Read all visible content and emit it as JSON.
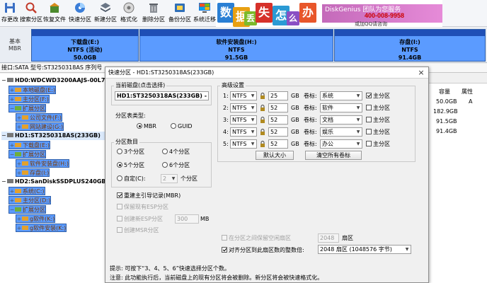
{
  "toolbar": {
    "buttons": [
      {
        "label": "存更改",
        "icon": "save-icon"
      },
      {
        "label": "搜索分区",
        "icon": "search-partition-icon"
      },
      {
        "label": "恢复文件",
        "icon": "recover-files-icon"
      },
      {
        "label": "快速分区",
        "icon": "quick-partition-icon"
      },
      {
        "label": "新建分区",
        "icon": "new-partition-icon"
      },
      {
        "label": "格式化",
        "icon": "format-icon"
      },
      {
        "label": "删除分区",
        "icon": "delete-partition-icon"
      },
      {
        "label": "备份分区",
        "icon": "backup-partition-icon"
      },
      {
        "label": "系统迁移",
        "icon": "system-migration-icon"
      }
    ]
  },
  "banner": {
    "chars": [
      "数",
      "据",
      "丢",
      "失",
      "怎",
      "么",
      "办"
    ],
    "brand": "DiskGenius 团队为您服务",
    "phone": "400-008-9958",
    "qq": "或加QQ请咨询"
  },
  "diskbar": {
    "disk_label_line1": "基本",
    "disk_label_line2": "MBR",
    "partitions": [
      {
        "name": "下载盘(E:)",
        "fs": "NTFS (活动)",
        "size": "50.0GB"
      },
      {
        "name": "软件安装盘(H:)",
        "fs": "NTFS",
        "size": "91.5GB"
      },
      {
        "name": "存盘(I:)",
        "fs": "NTFS",
        "size": "91.4GB"
      }
    ]
  },
  "infoline": "接口:SATA  型号:ST3250318AS  序列号",
  "tree": {
    "nodes": [
      {
        "text": "HD0:WDCWD3200AAJS-00L7A0(2",
        "kind": "disk"
      },
      {
        "text": "本地磁盘(E:)",
        "kind": "part"
      },
      {
        "text": "主分区(F:)",
        "kind": "part"
      },
      {
        "text": "扩展分区",
        "kind": "part"
      },
      {
        "text": "公司文件(F:)",
        "kind": "part"
      },
      {
        "text": "网站建设(G:)",
        "kind": "part"
      },
      {
        "text": "HD1:ST3250318AS(233GB)",
        "kind": "disk"
      },
      {
        "text": "下载盘(E:)",
        "kind": "part"
      },
      {
        "text": "扩展分区",
        "kind": "part"
      },
      {
        "text": "软件安装盘(H:)",
        "kind": "part"
      },
      {
        "text": "存盘(I:)",
        "kind": "part"
      },
      {
        "text": "HD2:SanDiskSSDPLUS240GB(224",
        "kind": "disk"
      },
      {
        "text": "系统(C:)",
        "kind": "part"
      },
      {
        "text": "主分区(D:)",
        "kind": "part"
      },
      {
        "text": "扩展分区",
        "kind": "part"
      },
      {
        "text": "g软件(K:)",
        "kind": "part"
      },
      {
        "text": "g软件安装(K:)",
        "kind": "part"
      }
    ]
  },
  "rtable": {
    "col_capacity": "容量",
    "col_attr": "属性",
    "rows": [
      {
        "capacity": "50.0GB",
        "attr": "A"
      },
      {
        "capacity": "182.9GB",
        "attr": ""
      },
      {
        "capacity": "91.5GB",
        "attr": ""
      },
      {
        "capacity": "91.4GB",
        "attr": ""
      }
    ]
  },
  "dialog": {
    "title": "快速分区 - HD1:ST3250318AS(233GB)",
    "close": "×",
    "current_disk_group": "当前磁盘(点击选择)",
    "current_disk_value": "HD1:ST3250318AS(233GB) - 下载盘",
    "table_type_group": "分区表类型:",
    "mbr": "MBR",
    "guid": "GUID",
    "count_group": "分区数目",
    "count_options": [
      "3个分区",
      "4个分区",
      "5个分区",
      "6个分区"
    ],
    "custom_label": "自定(C):",
    "custom_value": "2",
    "custom_unit": "个分区",
    "rebuild_mbr": "重建主引导记录(MBR)",
    "keep_esp": "保留现有ESP分区",
    "create_esp": "创建新ESP分区",
    "esp_size": "300",
    "esp_unit": "MB",
    "create_msr": "创建MSR分区",
    "advanced_group": "高级设置",
    "rows": [
      {
        "idx": "1:",
        "fs": "NTFS",
        "size": "25",
        "unit": "GB",
        "vol_label": "卷标:",
        "vol": "系统",
        "primary": true,
        "primary_label": "主分区"
      },
      {
        "idx": "2:",
        "fs": "NTFS",
        "size": "52",
        "unit": "GB",
        "vol_label": "卷标:",
        "vol": "软件",
        "primary": false,
        "primary_label": "主分区"
      },
      {
        "idx": "3:",
        "fs": "NTFS",
        "size": "52",
        "unit": "GB",
        "vol_label": "卷标:",
        "vol": "文档",
        "primary": false,
        "primary_label": "主分区"
      },
      {
        "idx": "4:",
        "fs": "NTFS",
        "size": "52",
        "unit": "GB",
        "vol_label": "卷标:",
        "vol": "娱乐",
        "primary": false,
        "primary_label": "主分区"
      },
      {
        "idx": "5:",
        "fs": "NTFS",
        "size": "52",
        "unit": "GB",
        "vol_label": "卷标:",
        "vol": "办公",
        "primary": false,
        "primary_label": "主分区"
      }
    ],
    "default_size_btn": "默认大小",
    "clear_labels_btn": "清空所有卷标",
    "keep_unalloc": "在分区之间保留空闲扇区",
    "unalloc_value": "2048",
    "unalloc_unit": "扇区",
    "align_label": "对齐分区到此扇区数的整数倍:",
    "align_value": "2048 扇区 (1048576 字节)",
    "tip1": "提示: 可按下“3、4、5、6”快速选择分区个数。",
    "tip2": "注意: 此功能执行后，当前磁盘上的现有分区将会被删除。新分区将会被快速格式化。"
  }
}
